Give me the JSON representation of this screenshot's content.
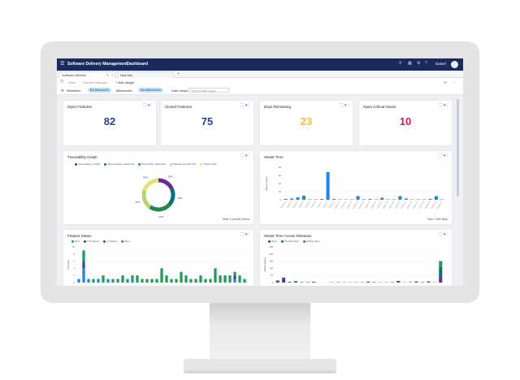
{
  "app": {
    "name": "Software Delivery Management",
    "page": "Dashboard",
    "user": "Daniel"
  },
  "tabs": [
    {
      "label": "Software Metrics"
    },
    {
      "label": "New tab"
    }
  ],
  "toolbar": {
    "save_label": "Save",
    "discard_label": "Discard changes",
    "add_widget_label": "+ Add widget"
  },
  "filters": {
    "releases_label": "Releases:",
    "releases_value": "BA-Release03",
    "milestones_label": "Milestones:",
    "milestones_value": "BA-Milestone04",
    "date_range_label": "Date range:",
    "date_range_placeholder": "Select a date range"
  },
  "kpis": [
    {
      "title": "Open Features",
      "value": "82",
      "color": "#2a3f9d"
    },
    {
      "title": "Closed Features",
      "value": "75",
      "color": "#2a3f9d"
    },
    {
      "title": "Days Remaining",
      "value": "23",
      "color": "#f2c12e"
    },
    {
      "title": "Open Critical Issues",
      "value": "10",
      "color": "#d11a5a"
    }
  ],
  "traceability": {
    "title": "Traceability Graph",
    "legend": [
      "Java Gallery_Insight",
      "Java Inherited Javascript",
      "Prompt/DG_wiki/notes",
      "Strategy and API Doc",
      "Support API"
    ],
    "footer": "Total: 6 (visible) items",
    "chart_data": {
      "type": "pie",
      "title": "Traceability Graph",
      "categories": [
        "Java Gallery_Insight",
        "Java Inherited Javascript",
        "Prompt/DG_wiki/notes",
        "Strategy and API Doc",
        "Support API"
      ],
      "values": [
        18,
        18,
        23,
        20,
        20
      ],
      "colors": [
        "#6a2c91",
        "#0f6e7e",
        "#1f8a4c",
        "#b8d36b",
        "#e4e07a"
      ],
      "data_labels": [
        "18%",
        "18%",
        "23%",
        "20%",
        "20%"
      ]
    }
  },
  "waste_time": {
    "title": "Waste Time",
    "ylabel": "Waste (days)",
    "footer": "Total: 1359 days",
    "chart_data": {
      "type": "bar",
      "title": "Waste Time",
      "ylabel": "Waste (days)",
      "ylim": [
        0,
        80
      ],
      "yticks": [
        0,
        20,
        40,
        60,
        80
      ],
      "categories": [
        "Feature 1",
        "Feature 2",
        "Feature 3",
        "Feature 4",
        "Feature 5",
        "Feature 6",
        "Feature 7",
        "Feature 8",
        "Feature 9",
        "Feature 10",
        "Feature 11",
        "Feature 12",
        "Feature 13",
        "Feature 14",
        "Feature 15",
        "Feature 16",
        "Feature 17",
        "Feature 18",
        "Feature 19",
        "Feature 20",
        "Feature 21",
        "Feature 22",
        "Feature 23",
        "Feature 24",
        "Feature 25",
        "Feature 26",
        "Feature 27"
      ],
      "values": [
        2,
        3,
        6,
        10,
        1,
        1,
        2,
        68,
        2,
        1,
        1,
        1,
        9,
        1,
        2,
        1,
        5,
        1,
        1,
        9,
        3,
        1,
        1,
        1,
        2,
        9,
        1
      ],
      "color": "#1e88e5"
    }
  },
  "feature_status": {
    "title": "Feature Status",
    "ylabel": "Features",
    "legend": [
      "New",
      "In Progress",
      "In Testing",
      "Done"
    ],
    "chart_data": {
      "type": "bar",
      "title": "Feature Status",
      "ylabel": "Features",
      "yticks": [
        0,
        2,
        4,
        6,
        8,
        10
      ],
      "ylim": [
        0,
        10
      ],
      "series": [
        {
          "name": "New",
          "color": "#1e88e5",
          "values": [
            1,
            4,
            1,
            0,
            1,
            0,
            1,
            0,
            0,
            0,
            0,
            1,
            0,
            0,
            0,
            0,
            0,
            0,
            0,
            0,
            0,
            0,
            0,
            0,
            0,
            0,
            0,
            0,
            0,
            0,
            0,
            0,
            1,
            0,
            0
          ]
        },
        {
          "name": "In Progress",
          "color": "#6a2c91",
          "values": [
            0,
            1,
            0,
            0,
            0,
            0,
            0,
            0,
            0,
            0,
            0,
            0,
            0,
            0,
            0,
            0,
            0,
            0,
            0,
            0,
            0,
            0,
            0,
            0,
            0,
            0,
            0,
            0,
            0,
            0,
            0,
            0,
            1,
            0,
            0
          ]
        },
        {
          "name": "In Testing",
          "color": "#0f6e7e",
          "values": [
            0,
            1,
            0,
            0,
            0,
            0,
            0,
            0,
            0,
            0,
            0,
            0,
            0,
            0,
            0,
            0,
            0,
            0,
            0,
            0,
            0,
            0,
            0,
            0,
            0,
            0,
            0,
            0,
            0,
            0,
            0,
            0,
            0,
            0,
            0
          ]
        },
        {
          "name": "Done",
          "color": "#1f9e5a",
          "values": [
            0,
            3,
            0,
            1,
            0,
            2,
            0,
            1,
            1,
            2,
            1,
            1,
            2,
            1,
            1,
            1,
            1,
            4,
            2,
            1,
            1,
            3,
            2,
            1,
            1,
            2,
            1,
            1,
            4,
            2,
            2,
            2,
            1,
            2,
            1
          ]
        }
      ]
    }
  },
  "waste_across_releases": {
    "title": "Waste Time Across Releases",
    "ylabel": "Waste (days)",
    "legend": [
      "Days",
      "Pending days",
      "Ending days"
    ],
    "chart_data": {
      "type": "bar",
      "title": "Waste Time Across Releases",
      "ylabel": "Waste (days)",
      "ylim": [
        0,
        250
      ],
      "yticks": [
        0,
        50,
        100,
        150,
        200,
        250
      ],
      "series": [
        {
          "name": "Days",
          "color": "#6a2c91",
          "values": [
            10,
            25,
            0,
            5,
            0,
            0,
            5,
            0,
            0,
            0,
            0,
            0,
            0,
            0,
            0,
            5,
            0,
            0,
            0,
            0,
            10,
            0,
            0,
            5,
            0,
            5,
            0,
            40
          ]
        },
        {
          "name": "Pending days",
          "color": "#0f6e7e",
          "values": [
            5,
            10,
            5,
            5,
            3,
            3,
            0,
            0,
            0,
            2,
            2,
            2,
            2,
            2,
            2,
            2,
            3,
            2,
            2,
            3,
            2,
            2,
            3,
            3,
            3,
            3,
            2,
            70
          ]
        },
        {
          "name": "Ending days",
          "color": "#1f9e5a",
          "values": [
            0,
            0,
            0,
            0,
            0,
            0,
            0,
            0,
            0,
            0,
            0,
            0,
            0,
            0,
            0,
            0,
            0,
            0,
            0,
            0,
            0,
            0,
            0,
            0,
            0,
            0,
            0,
            40
          ]
        }
      ]
    }
  }
}
